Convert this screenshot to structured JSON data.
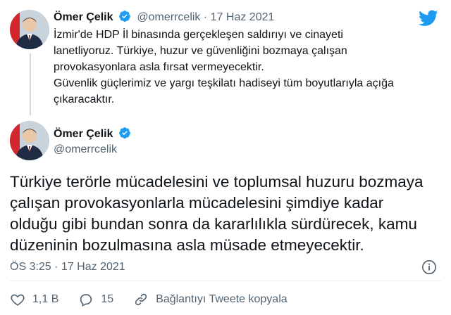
{
  "parent": {
    "name": "Ömer Çelik",
    "handle": "@omerrcelik",
    "separator": "·",
    "date": "17 Haz 2021",
    "lines": [
      "İzmir'de HDP İl binasında gerçekleşen saldırıyı ve cinayeti",
      "lanetliyoruz. Türkiye, huzur ve güvenliğini bozmaya çalışan",
      "provokasyonlara asla fırsat vermeyecektir.",
      "Güvenlik güçlerimiz ve yargı teşkilatı hadiseyi tüm boyutlarıyla açığa",
      "çıkaracaktır."
    ]
  },
  "main": {
    "name": "Ömer Çelik",
    "handle": "@omerrcelik",
    "lines": [
      "Türkiye terörle mücadelesini ve toplumsal huzuru bozmaya",
      "çalışan provokasyonlarla mücadelesini şimdiye kadar",
      "olduğu gibi bundan sonra da kararlılıkla sürdürecek, kamu",
      "düzeninin bozulmasına asla müsade etmeyecektir."
    ],
    "time": "ÖS 3:25 · 17 Haz 2021"
  },
  "actions": {
    "likes": "1,1 B",
    "replies": "15",
    "copy_link": "Bağlantıyı Tweete kopyala"
  },
  "icons": {
    "verified": "verified-badge-icon",
    "logo": "twitter-bird-icon",
    "info": "info-icon",
    "like": "heart-icon",
    "reply": "reply-bubble-icon",
    "link": "link-icon"
  },
  "colors": {
    "brand": "#1d9bf0",
    "text": "#0f1419",
    "secondary": "#536471",
    "thread_line": "#cfd9de"
  }
}
